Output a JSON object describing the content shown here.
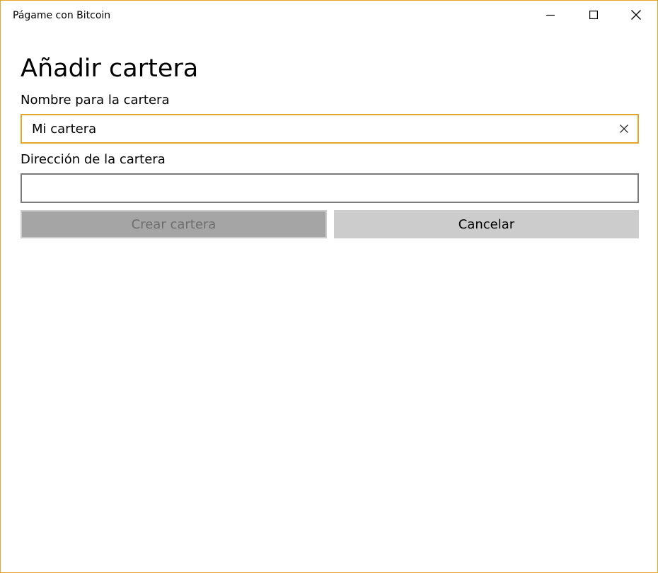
{
  "window": {
    "title": "Págame con Bitcoin",
    "accent_color": "#e3a62c",
    "controls": [
      "minimize-icon",
      "maximize-icon",
      "close-icon"
    ]
  },
  "page": {
    "title": "Añadir cartera"
  },
  "form": {
    "name_label": "Nombre para la cartera",
    "name_value": "Mi cartera",
    "address_label": "Dirección de la cartera",
    "address_value": ""
  },
  "buttons": {
    "create_label": "Crear cartera",
    "create_enabled": false,
    "cancel_label": "Cancelar"
  }
}
